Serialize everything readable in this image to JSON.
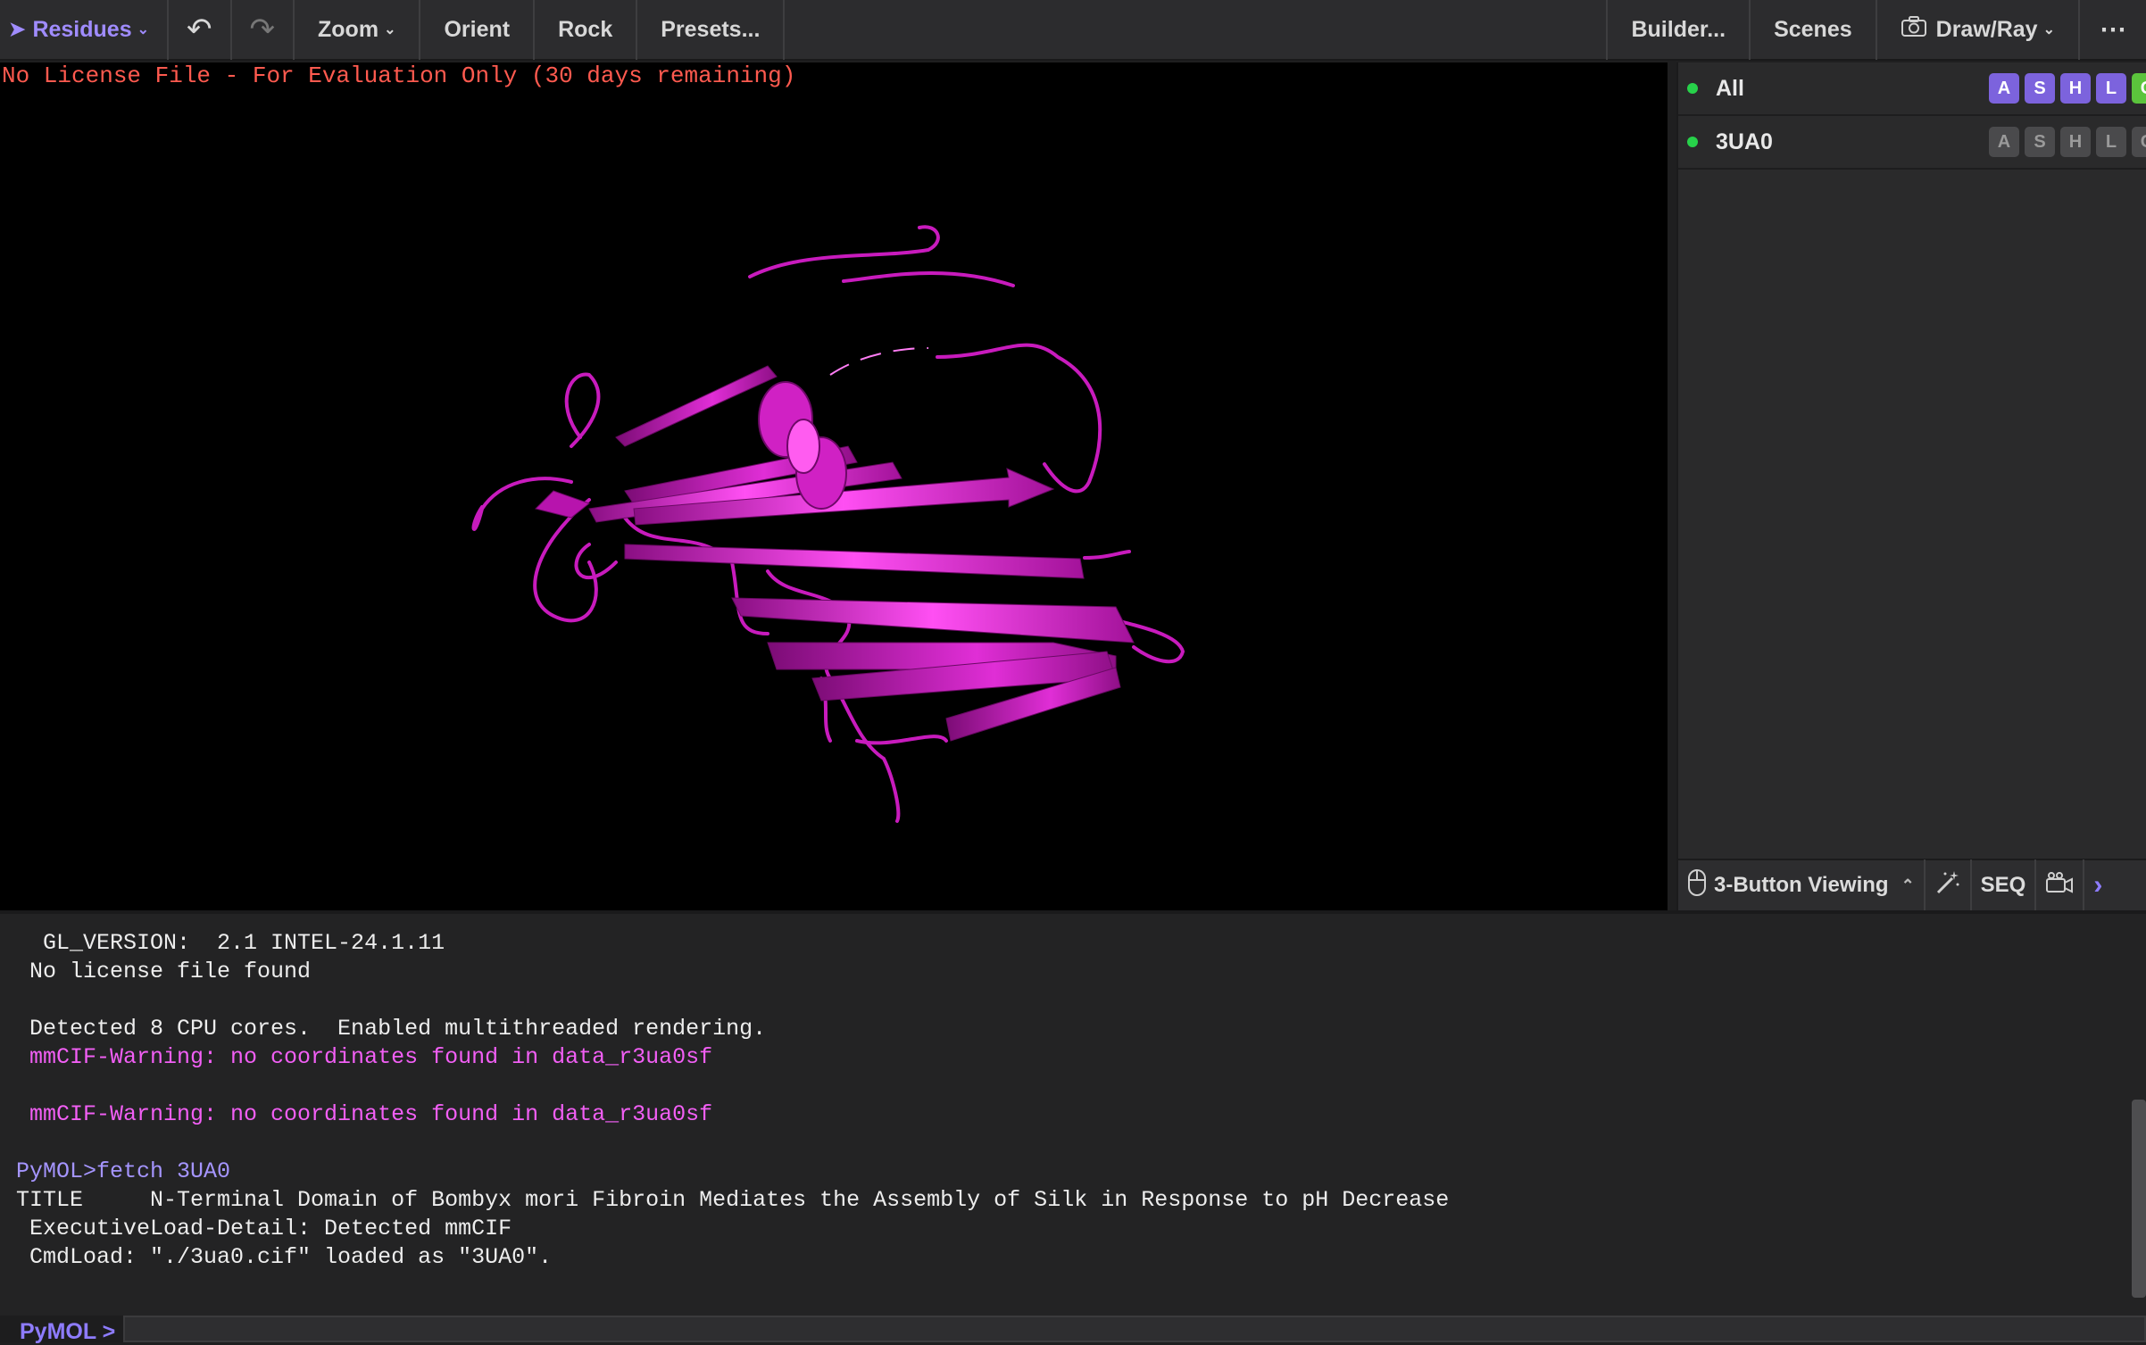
{
  "toolbar": {
    "mode_label": "Residues",
    "zoom_label": "Zoom",
    "orient_label": "Orient",
    "rock_label": "Rock",
    "presets_label": "Presets...",
    "builder_label": "Builder...",
    "scenes_label": "Scenes",
    "drawray_label": "Draw/Ray",
    "more_label": "⋯"
  },
  "viewport": {
    "license_text": "No License File - For Evaluation Only (30 days remaining)",
    "cartoon_color": "#d61bc9"
  },
  "objects": [
    {
      "name": "All",
      "buttons": [
        "A",
        "S",
        "H",
        "L",
        "C"
      ]
    },
    {
      "name": "3UA0",
      "buttons": [
        "A",
        "S",
        "H",
        "L",
        "C"
      ]
    }
  ],
  "panel_bottom": {
    "mouse_mode": "3-Button Viewing",
    "seq_label": "SEQ"
  },
  "console": {
    "lines": [
      {
        "text": "  GL_VERSION:  2.1 INTEL-24.1.11",
        "kind": "normal"
      },
      {
        "text": " No license file found",
        "kind": "normal"
      },
      {
        "text": "",
        "kind": "normal"
      },
      {
        "text": " Detected 8 CPU cores.  Enabled multithreaded rendering.",
        "kind": "normal"
      },
      {
        "text": " mmCIF-Warning: no coordinates found in data_r3ua0sf",
        "kind": "warn"
      },
      {
        "text": "",
        "kind": "normal"
      },
      {
        "text": " mmCIF-Warning: no coordinates found in data_r3ua0sf",
        "kind": "warn"
      },
      {
        "text": "",
        "kind": "normal"
      },
      {
        "text": "PyMOL>fetch 3UA0",
        "kind": "prompt"
      },
      {
        "text": "TITLE     N-Terminal Domain of Bombyx mori Fibroin Mediates the Assembly of Silk in Response to pH Decrease",
        "kind": "normal"
      },
      {
        "text": " ExecutiveLoad-Detail: Detected mmCIF",
        "kind": "normal"
      },
      {
        "text": " CmdLoad: \"./3ua0.cif\" loaded as \"3UA0\".",
        "kind": "normal"
      }
    ],
    "prompt_label": "PyMOL >",
    "input_value": ""
  }
}
